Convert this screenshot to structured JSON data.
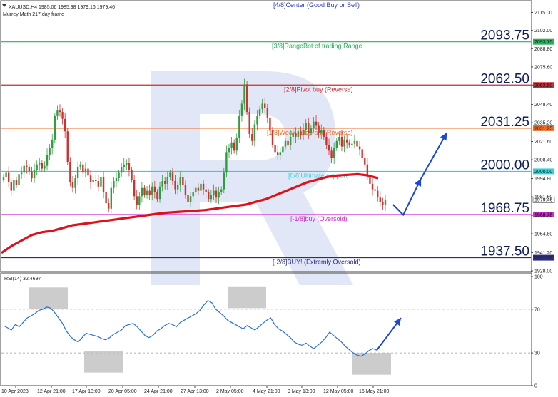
{
  "header": {
    "symbol_line": "XAUUSD,H4  1985.06 1985.98 1979.16 1979.46",
    "indicator_line": "Murrey Math 217 day frame"
  },
  "colors": {
    "bull": "#2e9e3f",
    "bear": "#d03030",
    "ma": "#e0101a",
    "arrow": "#1a47d8",
    "rsi": "#2a6fdb",
    "watermark": "#c9d3ee",
    "box": "#bfbfbf"
  },
  "chart_data": [
    {
      "type": "candlestick",
      "y_ticks": [
        "2115.00",
        "2102.00",
        "2088.80",
        "2075.60",
        "2062.50",
        "2048.40",
        "2035.20",
        "2021.60",
        "2008.40",
        "1994.80",
        "1981.60",
        "1968.20",
        "1954.80",
        "1941.20",
        "1928.00"
      ],
      "ylim": [
        1928.0,
        2115.0
      ],
      "x_labels": [
        "10 Apr 2023",
        "12 Apr 21:00",
        "17 Apr 13:00",
        "20 Apr 05:00",
        "24 Apr 21:00",
        "27 Apr 13:00",
        "2 May 05:00",
        "4 May 21:00",
        "9 May 13:00",
        "12 May 05:00",
        "16 May 21:00"
      ],
      "levels": [
        {
          "label": "[4/8]Center (Good Buy or Sell)",
          "price": 2125.0,
          "big_label": "",
          "tag": "",
          "color": "#2c3ec8"
        },
        {
          "label": "[3/8]RangeBot of trading Range",
          "price": 2093.75,
          "big_label": "2093.75",
          "tag": "2093.75",
          "color": "#2bb05a"
        },
        {
          "label": "[2/8]Pivot buy (Reverse)",
          "price": 2062.5,
          "big_label": "2062.50",
          "tag": "2062.50",
          "color": "#d0282e"
        },
        {
          "label": "[1/8]Weak, Stop and Reverse)",
          "price": 2031.25,
          "big_label": "2031.25",
          "tag": "2031.25",
          "color": "#ee6a22"
        },
        {
          "label": "[0/8]Ultimate support",
          "price": 2000.0,
          "big_label": "2000.00",
          "tag": "2000.00",
          "color": "#2cd4da"
        },
        {
          "label": "[-1/8]buy (Oversold)",
          "price": 1968.75,
          "big_label": "1968.75",
          "tag": "1968.75",
          "color": "#d02ad4"
        },
        {
          "label": "[-2/8]BUY! (Extremly Oversold)",
          "price": 1937.5,
          "big_label": "1937.50",
          "tag": "1937.50",
          "color": "#2a2c88"
        }
      ],
      "current_price": "1979.46",
      "closes": [
        1996,
        1999,
        1992,
        1986,
        1994,
        1990,
        1998,
        1999,
        2004,
        2003,
        2000,
        1995,
        2001,
        2005,
        2006,
        2002,
        2004,
        2012,
        2017,
        2023,
        2040,
        2044,
        2043,
        2038,
        2029,
        2007,
        1992,
        1988,
        1995,
        2003,
        2005,
        1999,
        2002,
        1997,
        1992,
        1994,
        1993,
        1989,
        1996,
        1985,
        1977,
        1973,
        1988,
        1993,
        1995,
        1999,
        2003,
        2005,
        2006,
        2001,
        1994,
        1982,
        1976,
        1982,
        1988,
        1983,
        1986,
        1983,
        1989,
        1985,
        1980,
        1989,
        1993,
        1991,
        1996,
        1999,
        1993,
        1987,
        1990,
        1996,
        1990,
        1983,
        1978,
        1982,
        1985,
        1988,
        1986,
        1991,
        1987,
        1985,
        1980,
        1983,
        1986,
        1981,
        1985,
        1987,
        1999,
        2014,
        2017,
        2021,
        2015,
        2024,
        2040,
        2049,
        2063,
        2043,
        2027,
        2022,
        2034,
        2040,
        2045,
        2049,
        2046,
        2039,
        2030,
        2019,
        2014,
        2012,
        2014,
        2018,
        2022,
        2019,
        2025,
        2028,
        2025,
        2029,
        2026,
        2030,
        2035,
        2028,
        2031,
        2036,
        2033,
        2028,
        2030,
        2025,
        2019,
        2015,
        2010,
        2017,
        2022,
        2025,
        2018,
        2023,
        2021,
        2019,
        2020,
        2022,
        2018,
        2016,
        2010,
        2005,
        1997,
        1991,
        1987,
        1986,
        1981,
        1978,
        1976,
        1979
      ],
      "ma_217": [
        1941,
        1946,
        1950,
        1954,
        1956,
        1957,
        1959,
        1961,
        1962,
        1963,
        1964,
        1965,
        1966,
        1967,
        1968,
        1969,
        1970,
        1970.5,
        1971,
        1971.5,
        1972,
        1973,
        1974,
        1975,
        1976,
        1978,
        1980,
        1983,
        1986,
        1989,
        1992,
        1994,
        1996,
        1997,
        1997.5,
        1998,
        1997,
        1995
      ],
      "projection": [
        {
          "t": 152,
          "price": 1976
        },
        {
          "t": 156,
          "price": 1968.5
        },
        {
          "t": 163,
          "price": 1995
        },
        {
          "t": 173,
          "price": 2028
        }
      ]
    },
    {
      "type": "line",
      "label": "RSI(14) 32.4697",
      "y_ticks": [
        "100",
        "70",
        "30",
        "0"
      ],
      "ylim": [
        0,
        100
      ],
      "values": [
        55,
        53,
        51,
        56,
        54,
        58,
        62,
        64,
        66,
        69,
        70,
        72,
        71,
        67,
        62,
        57,
        50,
        45,
        42,
        40,
        44,
        48,
        47,
        46,
        45,
        43,
        42,
        44,
        47,
        49,
        51,
        55,
        56,
        57,
        54,
        50,
        46,
        44,
        46,
        50,
        52,
        55,
        57,
        56,
        54,
        58,
        60,
        62,
        64,
        66,
        69,
        74,
        78,
        76,
        70,
        67,
        64,
        60,
        58,
        56,
        54,
        52,
        55,
        53,
        51,
        54,
        57,
        60,
        62,
        56,
        52,
        50,
        47,
        44,
        40,
        38,
        37,
        39,
        36,
        34,
        37,
        40,
        44,
        49,
        46,
        43,
        40,
        36,
        33,
        30,
        28,
        27,
        29,
        32,
        34,
        32.5
      ],
      "boxes": [
        {
          "x0": 40,
          "x1": 95,
          "y0": 70,
          "y1": 90
        },
        {
          "x0": 118,
          "x1": 172,
          "y0": 12,
          "y1": 32
        },
        {
          "x0": 320,
          "x1": 373,
          "y0": 71,
          "y1": 91
        },
        {
          "x0": 494,
          "x1": 548,
          "y0": 10,
          "y1": 30
        }
      ],
      "projection": [
        {
          "t": 0,
          "value": 32.5
        },
        {
          "t": 1,
          "value": 62
        }
      ]
    }
  ]
}
